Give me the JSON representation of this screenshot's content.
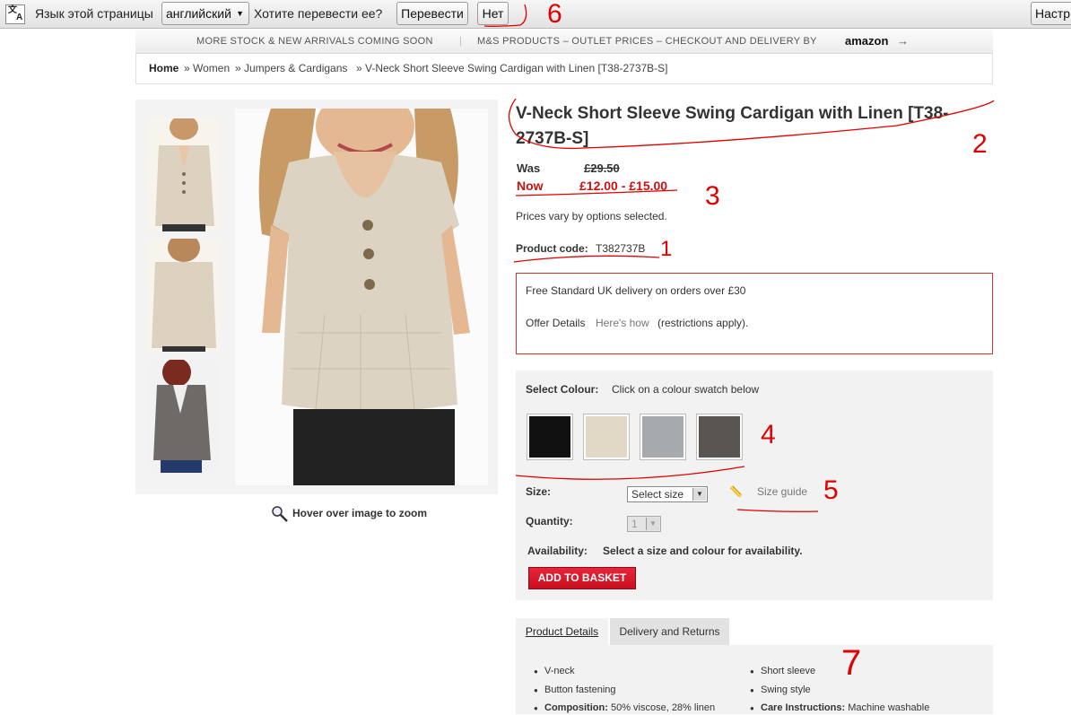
{
  "translate_bar": {
    "page_language_text": "Язык этой страницы",
    "language_value": "английский",
    "question": "Хотите перевести ее?",
    "translate_btn": "Перевести",
    "no_btn": "Нет",
    "settings_btn": "Настр"
  },
  "promo": {
    "left_text": "MORE STOCK & NEW ARRIVALS COMING SOON",
    "right_text": "M&S PRODUCTS – OUTLET PRICES – CHECKOUT AND DELIVERY BY",
    "brand": "amazon"
  },
  "breadcrumb": {
    "home": "Home",
    "women": "» Women",
    "category": "» Jumpers & Cardigans",
    "current": "» V-Neck Short Sleeve Swing Cardigan with Linen [T38-2737B-S]"
  },
  "gallery": {
    "zoom_hint": "Hover over image to zoom"
  },
  "product": {
    "title_line1": "V-Neck Short Sleeve Swing Cardigan with Linen [T38-",
    "title_line2": "2737B-S]",
    "was_label": "Was",
    "was_price": "£29.50",
    "now_label": "Now",
    "now_price": "£12.00 - £15.00",
    "price_note": "Prices vary by options selected.",
    "code_label": "Product code:",
    "code_value": "T382737B"
  },
  "offer": {
    "delivery_text": "Free Standard UK delivery on orders over £30",
    "details_label": "Offer Details",
    "details_link": "Here's how",
    "restrictions": "(restrictions apply)."
  },
  "options": {
    "colour_label": "Select Colour:",
    "colour_hint": "Click on a colour swatch below",
    "swatch_colors": [
      "#111111",
      "#e2d8c6",
      "#a7aaad",
      "#5a5452"
    ],
    "size_label": "Size:",
    "size_value": "Select size",
    "size_guide": "Size guide",
    "quantity_label": "Quantity:",
    "quantity_value": "1",
    "availability_label": "Availability:",
    "availability_text": "Select a size  and  colour for availability.",
    "add_to_basket": "ADD TO BASKET"
  },
  "tabs": {
    "details": "Product Details",
    "delivery": "Delivery and Returns",
    "bullets_left": [
      "V-neck",
      "Button fastening"
    ],
    "composition_label": "Composition:",
    "composition_value": "50% viscose, 28% linen",
    "bullets_right": [
      "Short sleeve",
      "Swing style"
    ],
    "care_label": "Care Instructions:",
    "care_value": "Machine washable"
  },
  "annotations": [
    "1",
    "2",
    "3",
    "4",
    "5",
    "6",
    "7"
  ],
  "colors": {
    "accent_red": "#c8101f",
    "price_red": "#cc1111",
    "annotation_red": "#e00000"
  }
}
